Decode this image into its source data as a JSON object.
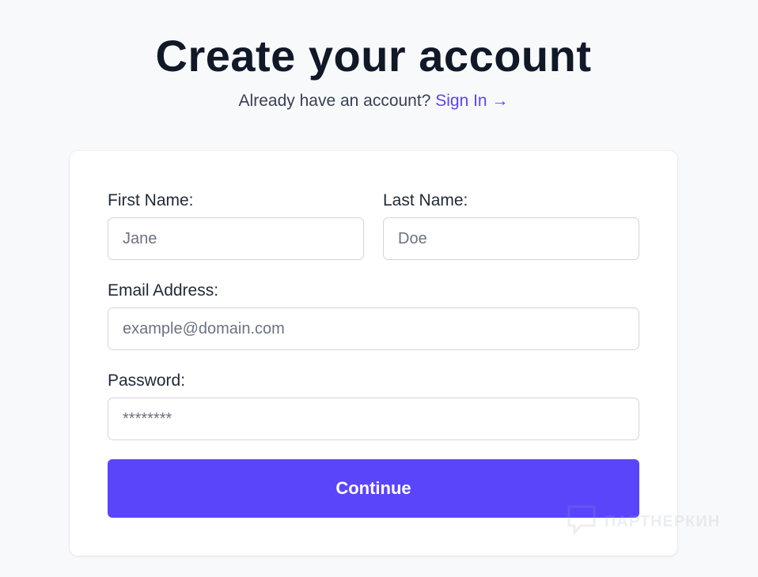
{
  "header": {
    "title": "Create your account",
    "subtitle_prefix": "Already have an account?",
    "sign_in_link": "Sign In →"
  },
  "form": {
    "first_name": {
      "label": "First Name:",
      "placeholder": "Jane",
      "value": ""
    },
    "last_name": {
      "label": "Last Name:",
      "placeholder": "Doe",
      "value": ""
    },
    "email": {
      "label": "Email Address:",
      "placeholder": "example@domain.com",
      "value": ""
    },
    "password": {
      "label": "Password:",
      "placeholder": "********",
      "value": ""
    },
    "submit_label": "Continue"
  },
  "watermark": {
    "text": "ПАРТНЕРКИН",
    "icon": "speech-bubble-icon"
  },
  "colors": {
    "accent": "#5a45fb",
    "link": "#5a45f5",
    "background": "#f8f9fb",
    "card": "#ffffff",
    "title": "#111827"
  }
}
